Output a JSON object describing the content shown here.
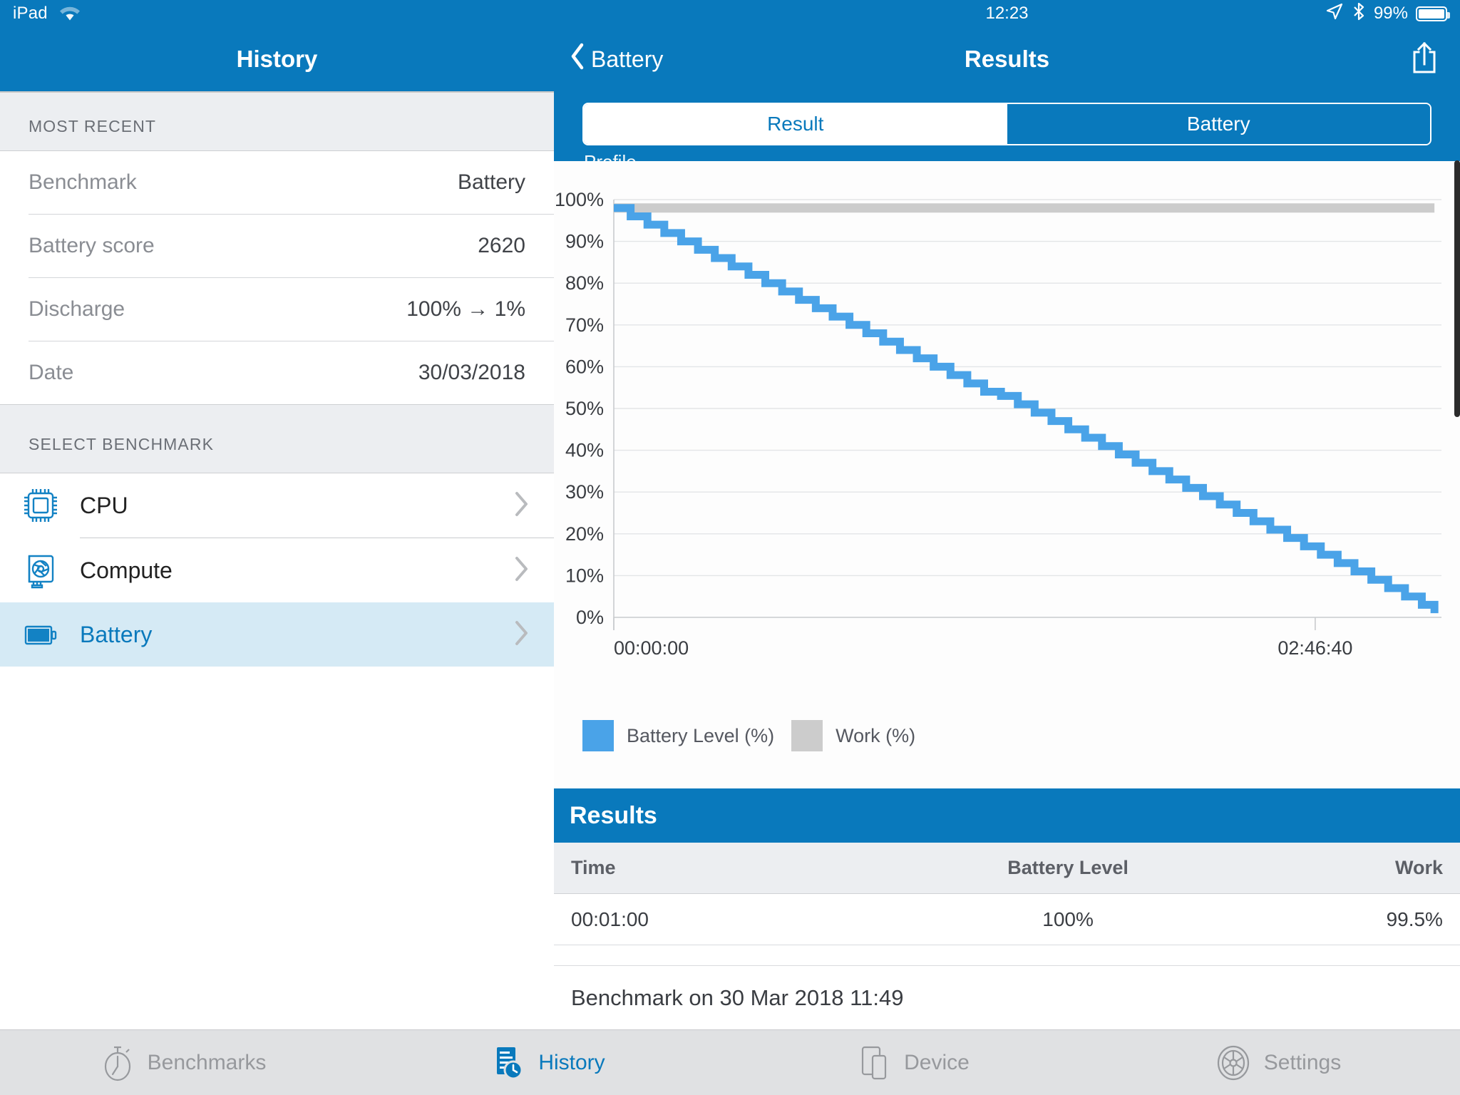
{
  "left": {
    "statusbar": {
      "device": "iPad",
      "wifi_icon": "wifi-icon"
    },
    "navbar": {
      "title": "History"
    },
    "most_recent": {
      "section_title": "MOST RECENT",
      "rows": [
        {
          "label": "Benchmark",
          "value": "Battery"
        },
        {
          "label": "Battery score",
          "value": "2620"
        },
        {
          "label": "Discharge",
          "value": "100% → 1%"
        },
        {
          "label": "Date",
          "value": "30/03/2018"
        }
      ]
    },
    "select_benchmark": {
      "section_title": "SELECT BENCHMARK",
      "items": [
        {
          "label": "CPU",
          "icon": "cpu-chip-icon",
          "selected": false
        },
        {
          "label": "Compute",
          "icon": "gpu-compute-icon",
          "selected": false
        },
        {
          "label": "Battery",
          "icon": "battery-icon",
          "selected": true
        }
      ]
    }
  },
  "right": {
    "statusbar": {
      "time": "12:23",
      "battery_percent": "99%",
      "location_icon": "location-arrow-icon",
      "bluetooth_icon": "bluetooth-icon",
      "battery_icon": "battery-status-icon"
    },
    "navbar": {
      "back_label": "Battery",
      "title": "Results",
      "share_icon": "share-icon"
    },
    "segmented": {
      "options": [
        "Result",
        "Battery"
      ],
      "selected": "Battery",
      "partial_text": "Profile"
    },
    "results_section": {
      "header": "Results",
      "columns": [
        "Time",
        "Battery Level",
        "Work"
      ],
      "rows": [
        {
          "time": "00:01:00",
          "battery_level": "100%",
          "work": "99.5%"
        }
      ]
    },
    "footer_note": "Benchmark on 30 Mar 2018 11:49"
  },
  "tabbar": {
    "tabs": [
      {
        "label": "Benchmarks",
        "icon": "stopwatch-icon",
        "active": false
      },
      {
        "label": "History",
        "icon": "history-document-clock-icon",
        "active": true
      },
      {
        "label": "Device",
        "icon": "device-icon",
        "active": false
      },
      {
        "label": "Settings",
        "icon": "gear-icon",
        "active": false
      }
    ]
  },
  "colors": {
    "brand_blue": "#0979BC",
    "series_battery": "#4AA3E8",
    "series_work": "#CCCCCC",
    "selected_row": "#D5EAF5",
    "section_bg": "#ECEEF1"
  },
  "chart_data": {
    "type": "line",
    "title": "",
    "xlabel": "",
    "ylabel": "",
    "grid": true,
    "legend_position": "bottom-left",
    "ylim": [
      0,
      100
    ],
    "ytick_labels": [
      "100%",
      "90%",
      "80%",
      "70%",
      "60%",
      "50%",
      "40%",
      "30%",
      "20%",
      "10%",
      "0%"
    ],
    "yticks": [
      100,
      90,
      80,
      70,
      60,
      50,
      40,
      30,
      20,
      10,
      0
    ],
    "xtick_labels": [
      "00:00:00",
      "02:46:40"
    ],
    "xticks": [
      0,
      10000
    ],
    "xlim": [
      0,
      11800
    ],
    "series": [
      {
        "name": "Battery Level (%)",
        "color": "#4AA3E8",
        "x": [
          0,
          240,
          480,
          720,
          960,
          1200,
          1440,
          1680,
          1920,
          2160,
          2400,
          2640,
          2880,
          3120,
          3360,
          3600,
          3840,
          4080,
          4320,
          4560,
          4800,
          5040,
          5280,
          5520,
          5760,
          6000,
          6240,
          6480,
          6720,
          6960,
          7200,
          7440,
          7680,
          7920,
          8160,
          8400,
          8640,
          8880,
          9120,
          9360,
          9600,
          9840,
          10080,
          10320,
          10560,
          10800,
          11040,
          11280,
          11520,
          11700
        ],
        "y": [
          98,
          96,
          94,
          92,
          90,
          88,
          86,
          84,
          82,
          80,
          78,
          76,
          74,
          72,
          70,
          68,
          66,
          64,
          62,
          60,
          58,
          56,
          54,
          53,
          51,
          49,
          47,
          45,
          43,
          41,
          39,
          37,
          35,
          33,
          31,
          29,
          27,
          25,
          23,
          21,
          19,
          17,
          15,
          13,
          11,
          9,
          7,
          5,
          3,
          1
        ]
      },
      {
        "name": "Work (%)",
        "color": "#CCCCCC",
        "x": [
          0,
          1000,
          2000,
          3000,
          4000,
          5000,
          6000,
          7000,
          8000,
          9000,
          10000,
          11000,
          11700
        ],
        "y": [
          98,
          98,
          98,
          98,
          98,
          98,
          98,
          98,
          98,
          98,
          98,
          98,
          98
        ]
      }
    ],
    "legend": [
      {
        "label": "Battery Level (%)",
        "color": "#4AA3E8"
      },
      {
        "label": "Work (%)",
        "color": "#CCCCCC"
      }
    ]
  }
}
